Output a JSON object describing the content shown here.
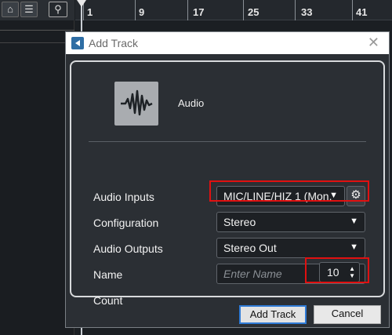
{
  "daw": {
    "toolbar_icons": [
      "home-icon",
      "list-icon",
      "search-icon"
    ],
    "ruler_bars": [
      "1",
      "9",
      "17",
      "25",
      "33",
      "41"
    ]
  },
  "dialog": {
    "title": "Add Track",
    "track_type": "Audio",
    "fields": {
      "audio_inputs": {
        "label": "Audio Inputs",
        "value": "MIC/LINE/HIZ 1 (Mon."
      },
      "configuration": {
        "label": "Configuration",
        "value": "Stereo"
      },
      "audio_outputs": {
        "label": "Audio Outputs",
        "value": "Stereo Out"
      },
      "name": {
        "label": "Name",
        "placeholder": "Enter Name"
      },
      "count": {
        "label": "Count",
        "value": "10"
      }
    },
    "buttons": {
      "add": "Add Track",
      "cancel": "Cancel"
    },
    "highlight_color": "#e01010"
  }
}
